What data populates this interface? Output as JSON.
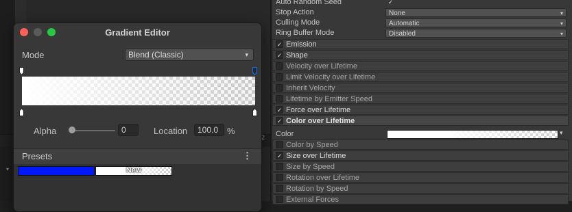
{
  "editor": {
    "title": "Gradient Editor",
    "mode_label": "Mode",
    "mode_value": "Blend (Classic)",
    "alpha_label": "Alpha",
    "alpha_value": "0",
    "location_label": "Location",
    "location_value": "100.0",
    "location_unit": "%",
    "presets_label": "Presets",
    "preset_new_label": "New",
    "preset_blue_color": "#0019ff"
  },
  "inspector": {
    "props": [
      {
        "label": "Auto Random Seed",
        "type": "check",
        "value": "✓"
      },
      {
        "label": "Stop Action",
        "type": "dropdown",
        "value": "None"
      },
      {
        "label": "Culling Mode",
        "type": "dropdown",
        "value": "Automatic"
      },
      {
        "label": "Ring Buffer Mode",
        "type": "dropdown",
        "value": "Disabled"
      }
    ],
    "modules": [
      {
        "label": "Emission",
        "enabled": true
      },
      {
        "label": "Shape",
        "enabled": true
      },
      {
        "label": "Velocity over Lifetime",
        "enabled": false
      },
      {
        "label": "Limit Velocity over Lifetime",
        "enabled": false
      },
      {
        "label": "Inherit Velocity",
        "enabled": false
      },
      {
        "label": "Lifetime by Emitter Speed",
        "enabled": false
      },
      {
        "label": "Force over Lifetime",
        "enabled": true
      },
      {
        "label": "Color over Lifetime",
        "enabled": true
      }
    ],
    "color_label": "Color",
    "modules_after": [
      {
        "label": "Color by Speed",
        "enabled": false
      },
      {
        "label": "Size over Lifetime",
        "enabled": true
      },
      {
        "label": "Size by Speed",
        "enabled": false
      },
      {
        "label": "Rotation over Lifetime",
        "enabled": false
      },
      {
        "label": "Rotation by Speed",
        "enabled": false
      },
      {
        "label": "External Forces",
        "enabled": false
      }
    ],
    "check_glyph": "✓"
  },
  "background": {
    "side_number": "2"
  },
  "icons": {
    "dropdown": "▾",
    "kebab": "⋮",
    "foldout": "▾"
  },
  "colors": {
    "selected_key": "#1f6fd1",
    "close": "#ff5f57",
    "minimize": "#5a5a5a",
    "zoom": "#28c840"
  }
}
